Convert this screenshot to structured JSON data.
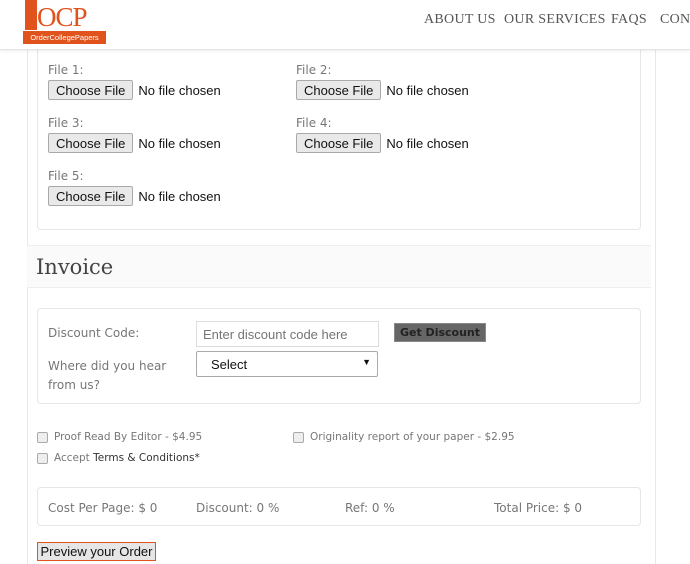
{
  "header": {
    "logo_text": "OCP",
    "logo_subtext": "OrderCollegePapers",
    "nav": [
      "ABOUT US",
      "OUR SERVICES",
      "FAQS",
      "CONT"
    ]
  },
  "files": [
    {
      "label": "File 1:",
      "button": "Choose File",
      "status": "No file chosen"
    },
    {
      "label": "File 2:",
      "button": "Choose File",
      "status": "No file chosen"
    },
    {
      "label": "File 3:",
      "button": "Choose File",
      "status": "No file chosen"
    },
    {
      "label": "File 4:",
      "button": "Choose File",
      "status": "No file chosen"
    },
    {
      "label": "File 5:",
      "button": "Choose File",
      "status": "No file chosen"
    }
  ],
  "invoice": {
    "title": "Invoice",
    "discount_label": "Discount Code:",
    "discount_placeholder": "Enter discount code here",
    "get_discount": "Get Discount",
    "hear_label": "Where did you hear from us?",
    "hear_value": "Select"
  },
  "options": {
    "proof_read": "Proof Read By Editor - $4.95",
    "originality": "Originality report of your paper - $2.95",
    "accept": "Accept",
    "terms": "Terms & Conditions*"
  },
  "totals": {
    "cost_per_page": "Cost Per Page: $  0",
    "discount": "Discount:  0 %",
    "ref": "Ref: 0 %",
    "total_price": "Total Price: $  0"
  },
  "preview_button": "Preview your Order",
  "colors": {
    "brand": "#e0531c",
    "get_discount_bg": "#666666"
  }
}
